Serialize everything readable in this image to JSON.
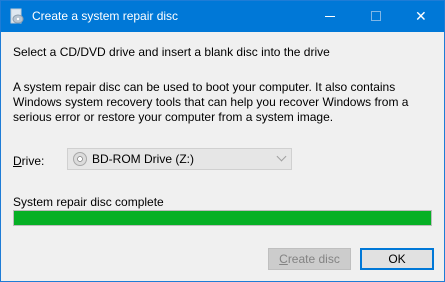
{
  "window": {
    "title": "Create a system repair disc",
    "controls": {
      "minimize": "—",
      "maximize": "☐",
      "close": "✕"
    }
  },
  "content": {
    "instruction": "Select a CD/DVD drive and insert a blank disc into the drive",
    "description_lines": [
      "A system repair disc can be used to boot your computer. It also contains",
      "Windows system recovery tools that can help you recover Windows from a",
      "serious error or restore your computer from a system image."
    ]
  },
  "drive": {
    "label_mnemonic": "D",
    "label_rest": "rive:",
    "selected": "BD-ROM Drive (Z:)",
    "icon": "disc-icon"
  },
  "progress": {
    "status": "System repair disc complete",
    "percent": 100
  },
  "buttons": {
    "create_mnemonic": "C",
    "create_rest": "reate disc",
    "create_enabled": false,
    "ok": "OK"
  },
  "colors": {
    "titlebar": "#0078d7",
    "progress_fill": "#06b025",
    "window_bg": "#f0f0f0"
  }
}
